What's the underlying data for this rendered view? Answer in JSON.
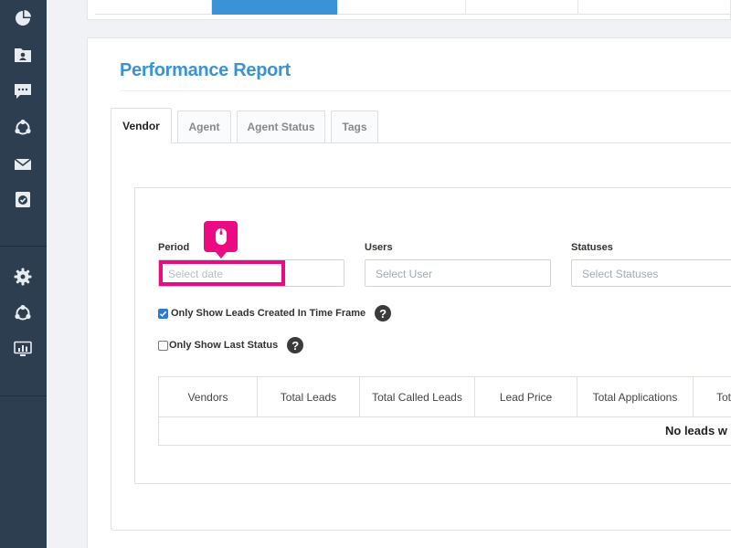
{
  "sidebar": {
    "items": [
      {
        "icon": "pie-chart-icon"
      },
      {
        "icon": "contact-folder-icon"
      },
      {
        "icon": "chat-bubble-icon"
      },
      {
        "icon": "share-network-icon"
      },
      {
        "icon": "envelope-icon"
      },
      {
        "icon": "clipboard-check-icon"
      },
      {
        "icon": "gear-icon"
      },
      {
        "icon": "share-network-icon"
      },
      {
        "icon": "monitor-chart-icon"
      }
    ]
  },
  "page": {
    "title": "Performance Report"
  },
  "tabs": [
    {
      "label": "Vendor",
      "active": true
    },
    {
      "label": "Agent",
      "active": false
    },
    {
      "label": "Agent Status",
      "active": false
    },
    {
      "label": "Tags",
      "active": false
    }
  ],
  "filters": {
    "period": {
      "label": "Period",
      "placeholder": "Select date"
    },
    "users": {
      "label": "Users",
      "placeholder": "Select User"
    },
    "statuses": {
      "label": "Statuses",
      "placeholder": "Select Statuses"
    }
  },
  "options": {
    "only_created": {
      "label": "Only Show Leads Created In Time Frame",
      "checked": true
    },
    "only_last_status": {
      "label": "Only Show Last Status",
      "checked": false
    }
  },
  "table": {
    "columns": [
      "Vendors",
      "Total Leads",
      "Total Called Leads",
      "Lead Price",
      "Total Applications",
      "Tot"
    ],
    "empty_message": "No leads w"
  },
  "colors": {
    "accent": "#3a93d6",
    "highlight": "#ec0a82",
    "sidebar": "#2c3e50"
  }
}
